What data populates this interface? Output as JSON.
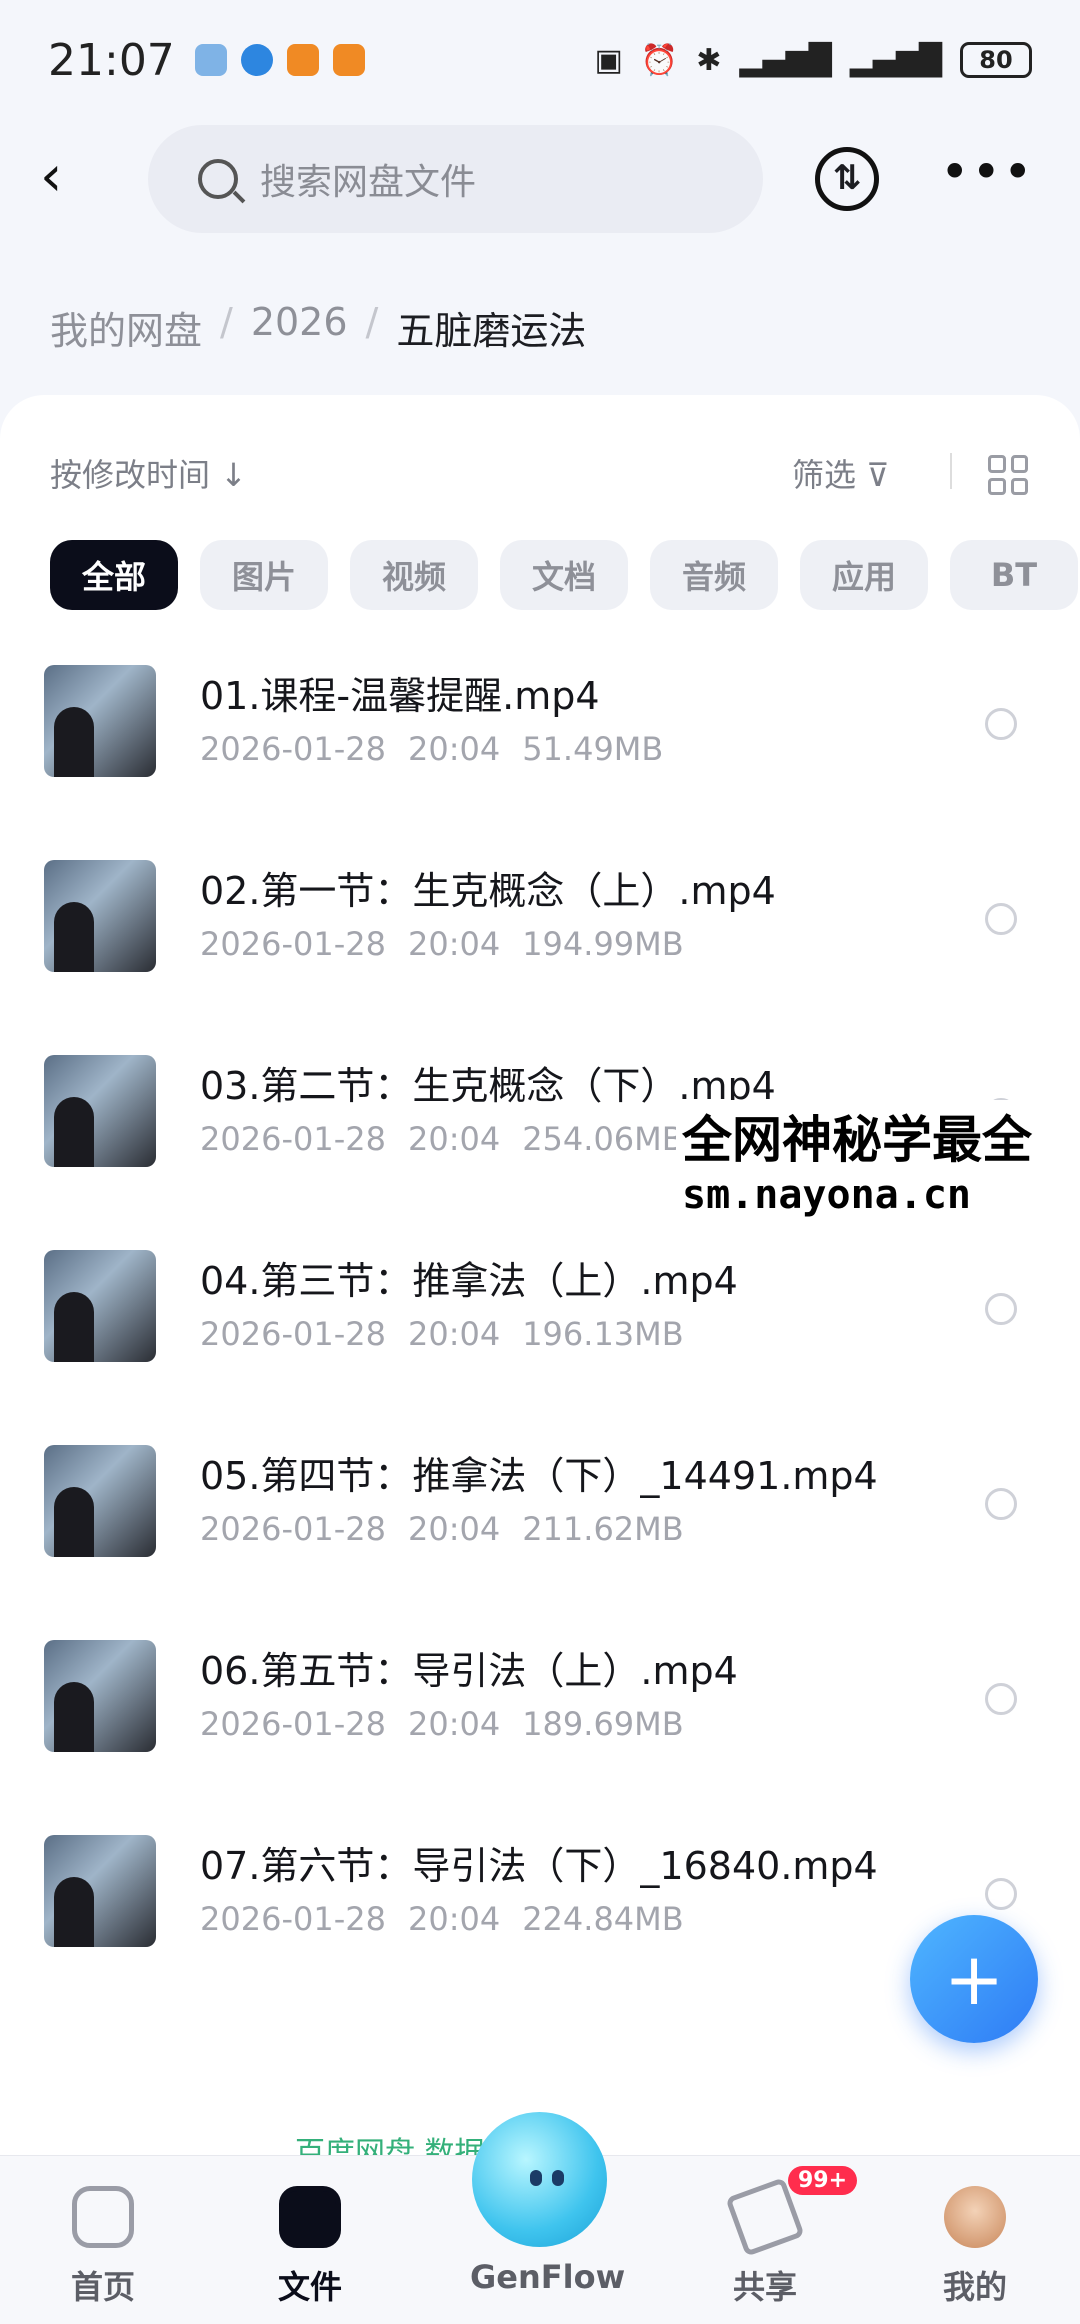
{
  "status_bar": {
    "time": "21:07",
    "battery": "80"
  },
  "search": {
    "placeholder": "搜索网盘文件"
  },
  "breadcrumb": {
    "items": [
      "我的网盘",
      "2026",
      "五脏磨运法"
    ],
    "separator": "/"
  },
  "toolbar": {
    "sort_label": "按修改时间 ↓",
    "filter_label": "筛选"
  },
  "filter_chips": [
    "全部",
    "图片",
    "视频",
    "文档",
    "音频",
    "应用",
    "BT"
  ],
  "active_chip": "全部",
  "files": [
    {
      "name": "01.课程-温馨提醒.mp4",
      "date": "2026-01-28",
      "time": "20:04",
      "size": "51.49MB"
    },
    {
      "name": "02.第一节：生克概念（上）.mp4",
      "date": "2026-01-28",
      "time": "20:04",
      "size": "194.99MB"
    },
    {
      "name": "03.第二节：生克概念（下）.mp4",
      "date": "2026-01-28",
      "time": "20:04",
      "size": "254.06MB"
    },
    {
      "name": "04.第三节：推拿法（上）.mp4",
      "date": "2026-01-28",
      "time": "20:04",
      "size": "196.13MB"
    },
    {
      "name": "05.第四节：推拿法（下）_14491.mp4",
      "date": "2026-01-28",
      "time": "20:04",
      "size": "211.62MB"
    },
    {
      "name": "06.第五节：导引法（上）.mp4",
      "date": "2026-01-28",
      "time": "20:04",
      "size": "189.69MB"
    },
    {
      "name": "07.第六节：导引法（下）_16840.mp4",
      "date": "2026-01-28",
      "time": "20:04",
      "size": "224.84MB"
    }
  ],
  "watermark": {
    "line1": "全网神秘学最全",
    "line2": "sm.nayona.cn"
  },
  "notice": "百度网盘 数据安全 ›",
  "tabs": [
    {
      "label": "首页"
    },
    {
      "label": "文件"
    },
    {
      "label": "GenFlow"
    },
    {
      "label": "共享",
      "badge": "99+"
    },
    {
      "label": "我的"
    }
  ],
  "colors": {
    "accent": "#2e7bf5",
    "active_chip_bg": "#0b0d1a",
    "badge": "#ff2d4d"
  }
}
